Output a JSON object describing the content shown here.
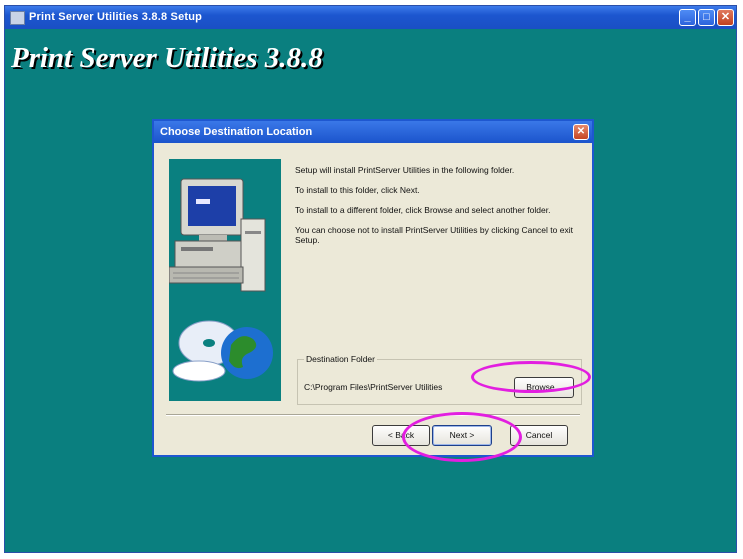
{
  "window": {
    "title": "Print Server Utilities 3.8.8 Setup",
    "min_glyph": "_",
    "max_glyph": "□",
    "close_glyph": "✕"
  },
  "banner": {
    "title": "Print Server Utilities 3.8.8"
  },
  "dialog": {
    "title": "Choose Destination Location",
    "close_glyph": "✕",
    "paragraphs": [
      "Setup will install PrintServer Utilities in the following folder.",
      "To install to this folder, click Next.",
      "To install to a different folder, click Browse and select another folder.",
      "You can choose not to install PrintServer Utilities by clicking Cancel to exit Setup."
    ],
    "destination": {
      "legend": "Destination Folder",
      "path": "C:\\Program Files\\PrintServer Utilities",
      "browse_label": "Browse..."
    },
    "buttons": {
      "back": "< Back",
      "next": "Next >",
      "cancel": "Cancel"
    }
  },
  "colors": {
    "desktop": "#0a7f7f",
    "titlebar": "#1c56cf",
    "dialog_bg": "#ece9d8",
    "highlight_ring": "#e21ee0"
  },
  "icons": [
    "app-icon",
    "computer-icon",
    "cd-globe-icon"
  ]
}
